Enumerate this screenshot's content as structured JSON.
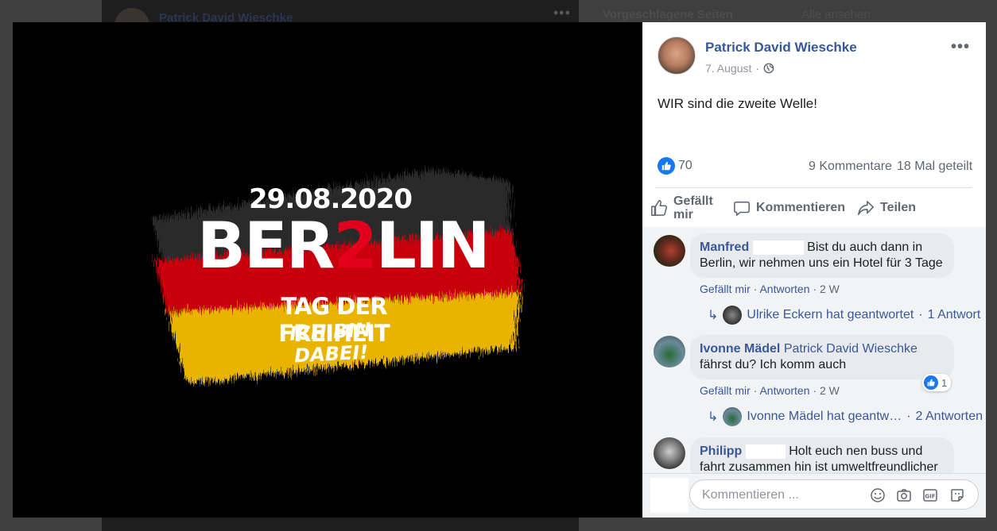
{
  "background": {
    "author_name": "Patrick David Wieschke",
    "more_label": "•••",
    "sidebar_title": "Vorgeschlagene Seiten",
    "sidebar_link": "Alle ansehen"
  },
  "photo": {
    "date": "29.08.2020",
    "title_prefix": "BER",
    "title_number": "2",
    "title_suffix": "LIN",
    "line1": "TAG DER FREIHEIT",
    "line2": "ICH BIN DABEI!",
    "flag_colors": [
      "#000000",
      "#dd0000",
      "#ffce00"
    ]
  },
  "post": {
    "author": "Patrick David Wieschke",
    "date": "7. August",
    "separator": "·",
    "privacy_icon": "globe-icon",
    "more_label": "•••",
    "text": "WIR sind die zweite Welle!",
    "reaction_count": "70",
    "comment_count": "9 Kommentare",
    "share_count": "18 Mal geteilt"
  },
  "actions": {
    "like": "Gefällt mir",
    "comment": "Kommentieren",
    "share": "Teilen"
  },
  "comments": [
    {
      "author": "Manfred",
      "text": "Bist du auch dann in Berlin, wir nehmen uns ein Hotel für 3 Tage",
      "like_label": "Gefällt mir",
      "reply_label": "Antworten",
      "age": "2 W",
      "replies_summary": "Ulrike Eckern hat geantwortet",
      "replies_count": "1 Antwort"
    },
    {
      "author": "Ivonne Mädel",
      "mention": "Patrick David Wieschke",
      "text": "fährst du? Ich komm auch",
      "likes": "1",
      "like_label": "Gefällt mir",
      "reply_label": "Antworten",
      "age": "2 W",
      "replies_summary": "Ivonne Mädel hat geantw…",
      "replies_count": "2 Antworten"
    },
    {
      "author": "Philipp",
      "text": "Holt euch nen buss und fahrt zusammen hin ist umweltfreundlicher"
    }
  ],
  "composer": {
    "placeholder": "Kommentieren ..."
  },
  "colors": {
    "link": "#385898",
    "like_blue": "#1877f2",
    "muted": "#606770"
  }
}
